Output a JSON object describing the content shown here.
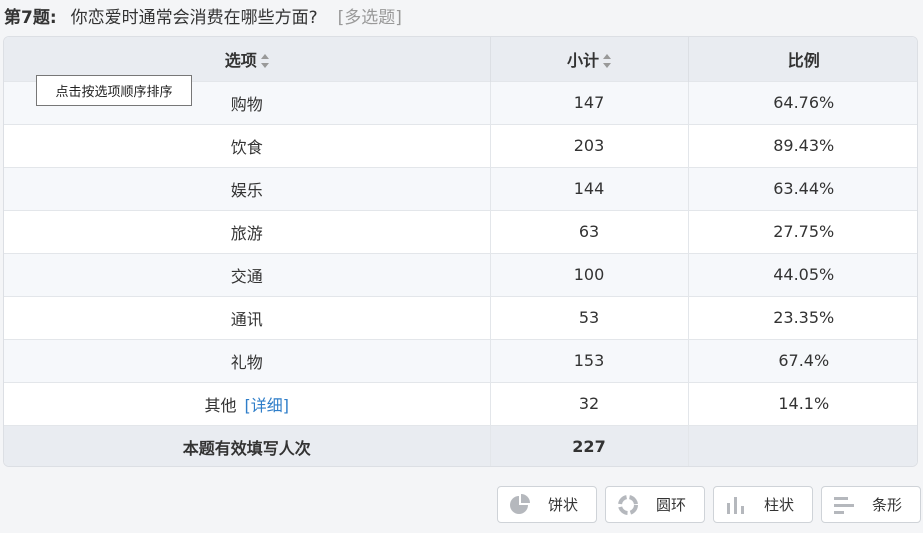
{
  "question": {
    "number": "第7题:",
    "text": "你恋爱时通常会消费在哪些方面?",
    "type": "[多选题]"
  },
  "table": {
    "headers": {
      "option": "选项",
      "count": "小计",
      "ratio": "比例"
    },
    "rows": [
      {
        "option": "购物",
        "count": "147",
        "ratio": "64.76%"
      },
      {
        "option": "饮食",
        "count": "203",
        "ratio": "89.43%"
      },
      {
        "option": "娱乐",
        "count": "144",
        "ratio": "63.44%"
      },
      {
        "option": "旅游",
        "count": "63",
        "ratio": "27.75%"
      },
      {
        "option": "交通",
        "count": "100",
        "ratio": "44.05%"
      },
      {
        "option": "通讯",
        "count": "53",
        "ratio": "23.35%"
      },
      {
        "option": "礼物",
        "count": "153",
        "ratio": "67.4%"
      },
      {
        "option": "其他",
        "detail": "[详细]",
        "count": "32",
        "ratio": "14.1%"
      }
    ],
    "total": {
      "label": "本题有效填写人次",
      "count": "227"
    }
  },
  "tooltip": "点击按选项顺序排序",
  "chart_buttons": {
    "pie": "饼状",
    "ring": "圆环",
    "column": "柱状",
    "bar": "条形"
  },
  "colors": {
    "icon": "#b5b8bd",
    "link": "#2f7ec9",
    "header_bg": "#e9ecf1"
  }
}
